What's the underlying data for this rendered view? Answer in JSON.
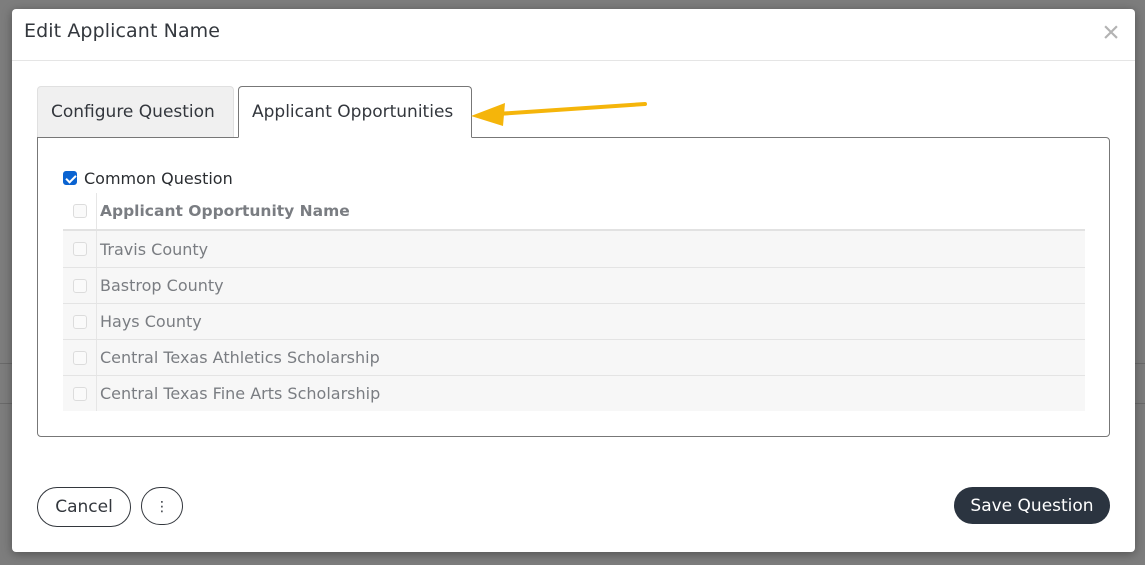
{
  "modal": {
    "title": "Edit Applicant Name",
    "close_glyph": "×"
  },
  "tabs": [
    {
      "label": "Configure Question",
      "active": false
    },
    {
      "label": "Applicant Opportunities",
      "active": true
    }
  ],
  "common_question": {
    "label": "Common Question",
    "checked": true
  },
  "table": {
    "header": "Applicant Opportunity Name",
    "rows": [
      {
        "name": "Travis County",
        "checked": false
      },
      {
        "name": "Bastrop County",
        "checked": false
      },
      {
        "name": "Hays County",
        "checked": false
      },
      {
        "name": "Central Texas Athletics Scholarship",
        "checked": false
      },
      {
        "name": "Central Texas Fine Arts Scholarship",
        "checked": false
      }
    ]
  },
  "footer": {
    "cancel_label": "Cancel",
    "more_glyph": "⋮",
    "save_label": "Save Question"
  },
  "colors": {
    "annotation_arrow": "#f5b50a",
    "checkbox_checked": "#0a63d1",
    "save_button_bg": "#2b3440"
  },
  "annotation": {
    "icon": "arrow-left-icon"
  }
}
